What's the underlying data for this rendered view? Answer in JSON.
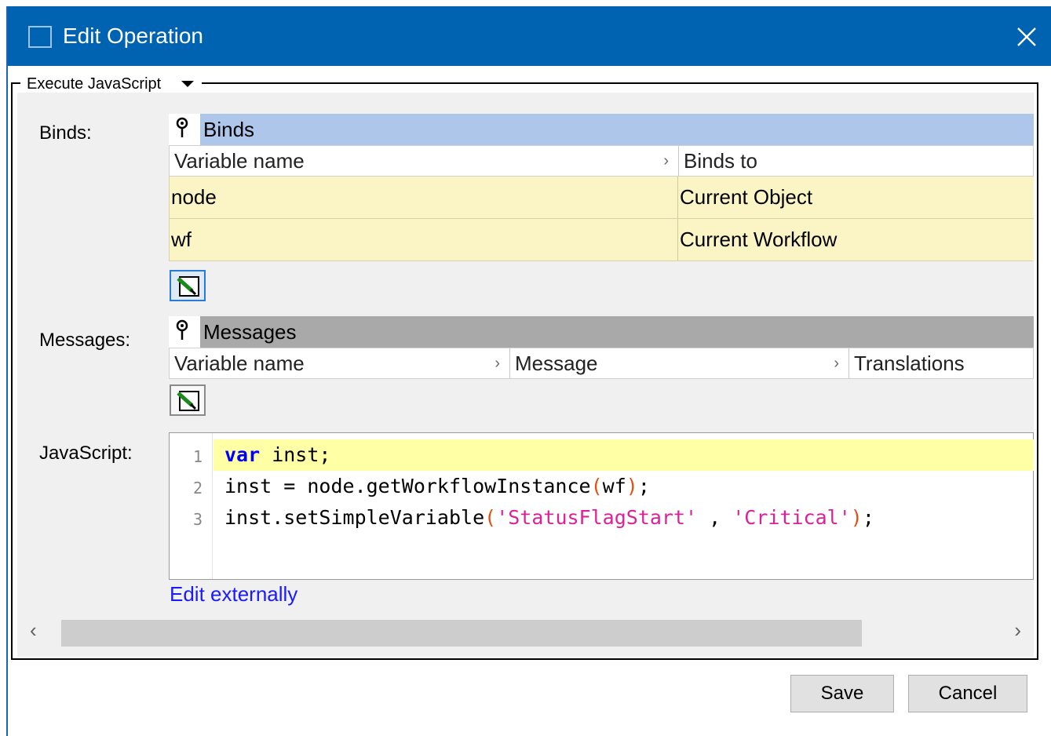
{
  "window": {
    "title": "Edit Operation",
    "close_glyph": "✕"
  },
  "group": {
    "legend": "Execute JavaScript"
  },
  "binds": {
    "label": "Binds:",
    "panel_title": "Binds",
    "columns": [
      "Variable name",
      "Binds to"
    ],
    "rows": [
      [
        "node",
        "Current Object"
      ],
      [
        "wf",
        "Current Workflow"
      ]
    ]
  },
  "messages": {
    "label": "Messages:",
    "panel_title": "Messages",
    "columns": [
      "Variable name",
      "Message",
      "Translations"
    ]
  },
  "javascript": {
    "label": "JavaScript:",
    "line_numbers": [
      "1",
      "2",
      "3"
    ],
    "lines": [
      {
        "kw": "var",
        "rest": " inst;"
      },
      {
        "a": "inst = node.getWorkflowInstance",
        "p1": "(",
        "b": "wf",
        "p2": ")",
        "c": ";"
      },
      {
        "a": "inst.setSimpleVariable",
        "p1": "(",
        "s1": "'StatusFlagStart'",
        "mid": " , ",
        "s2": "'Critical'",
        "p2": ")",
        "c": ";"
      }
    ],
    "edit_link": "Edit externally"
  },
  "scrollbar": {
    "left_arrow": "‹",
    "right_arrow": "›"
  },
  "buttons": {
    "save": "Save",
    "cancel": "Cancel"
  },
  "colors": {
    "titlebar": "#0063b1",
    "binds_header": "#adc6ea",
    "messages_header": "#a9a9a9",
    "row_bg": "#fbf5c5",
    "line_highlight": "#ffffa6",
    "keyword": "#0000ff",
    "string": "#dd2099",
    "link": "#1a1aff"
  },
  "icons": [
    "app-icon",
    "close-icon",
    "pin-icon",
    "edit-pencil-icon",
    "dropdown-arrow-icon"
  ]
}
